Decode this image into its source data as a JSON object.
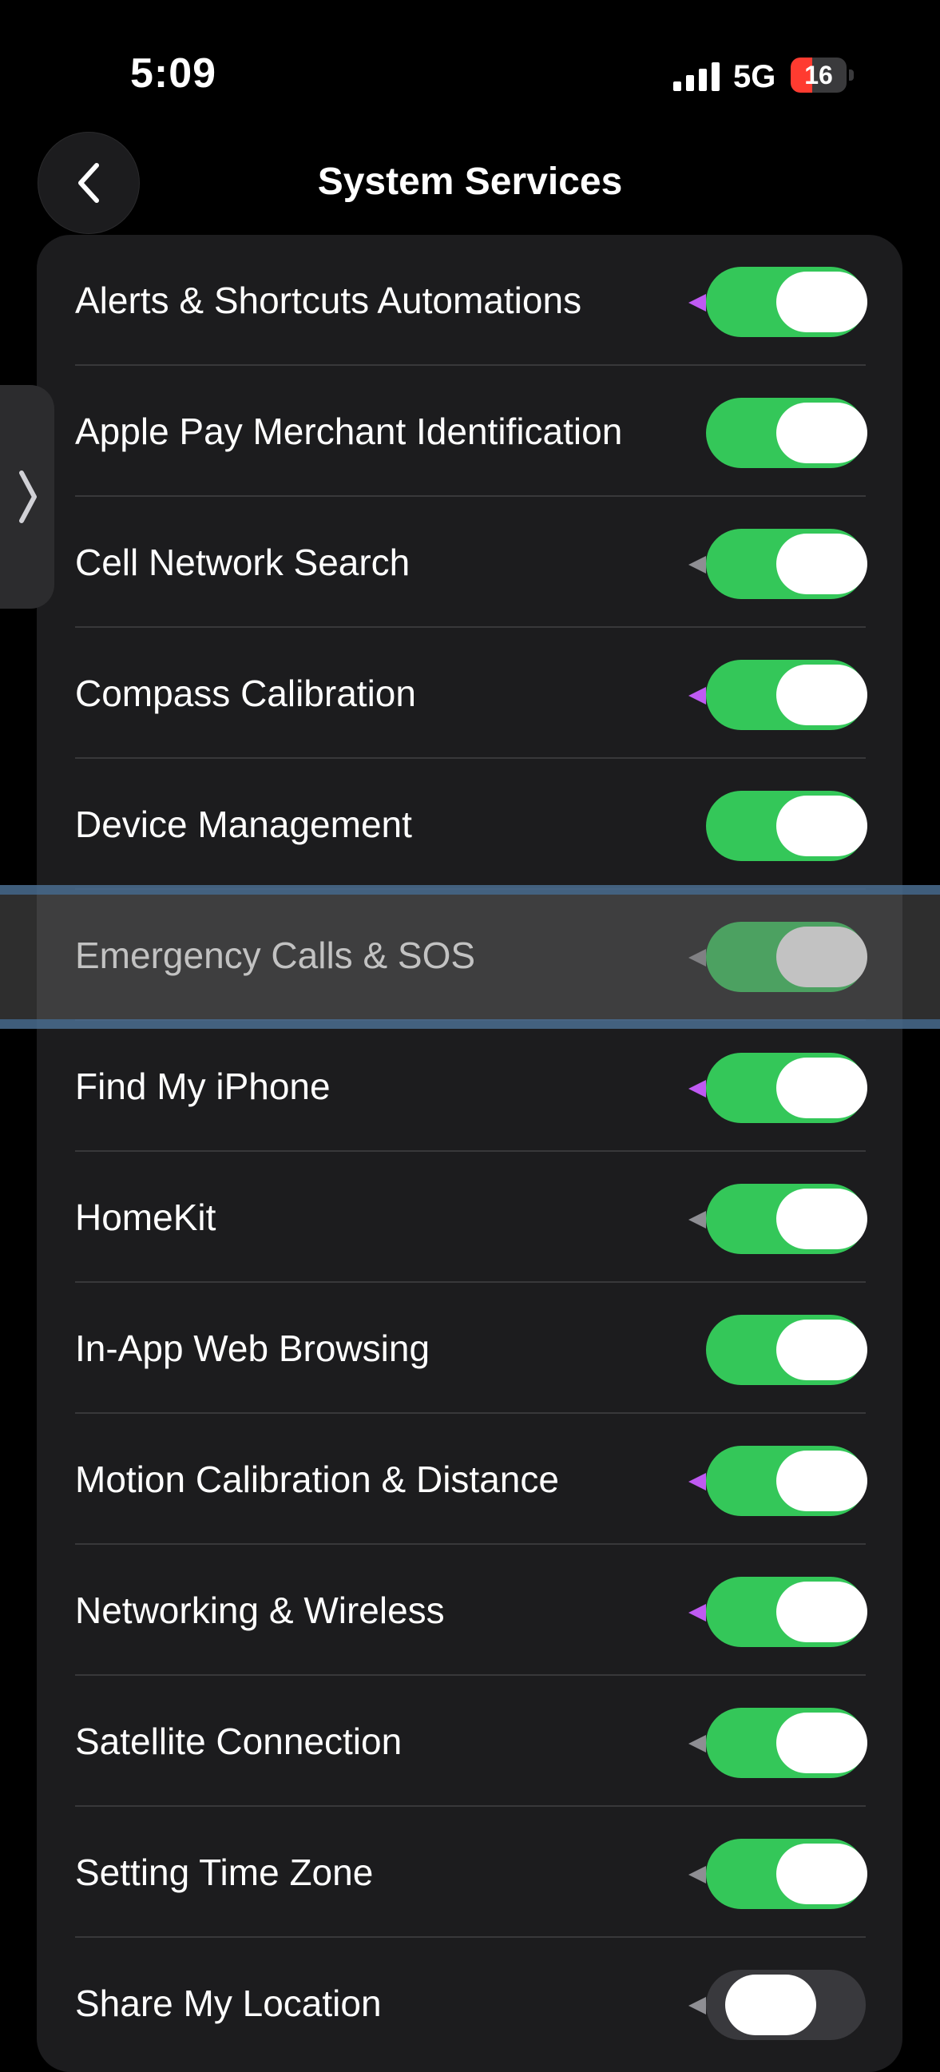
{
  "status_bar": {
    "time": "5:09",
    "network": "5G",
    "battery_level": "16",
    "battery_percent": 16,
    "battery_color": "#ff3b30"
  },
  "navigation": {
    "back_icon": "chevron-left-icon",
    "title": "System Services",
    "side_tab_icon": "chevron-right-icon"
  },
  "colors": {
    "toggle_on": "#34c759",
    "toggle_off": "#39393d",
    "location_recent": "#bf5af2",
    "location_used": "#8e8e93",
    "card": "#1c1c1e"
  },
  "services": [
    {
      "label": "Alerts & Shortcuts Automations",
      "on": true,
      "location_indicator": "purple"
    },
    {
      "label": "Apple Pay Merchant Identification",
      "on": true,
      "location_indicator": "none"
    },
    {
      "label": "Cell Network Search",
      "on": true,
      "location_indicator": "gray"
    },
    {
      "label": "Compass Calibration",
      "on": true,
      "location_indicator": "purple"
    },
    {
      "label": "Device Management",
      "on": true,
      "location_indicator": "none"
    },
    {
      "label": "Emergency Calls & SOS",
      "on": true,
      "location_indicator": "gray",
      "highlighted": true
    },
    {
      "label": "Find My iPhone",
      "on": true,
      "location_indicator": "purple"
    },
    {
      "label": "HomeKit",
      "on": true,
      "location_indicator": "gray"
    },
    {
      "label": "In-App Web Browsing",
      "on": true,
      "location_indicator": "none"
    },
    {
      "label": "Motion Calibration & Distance",
      "on": true,
      "location_indicator": "purple"
    },
    {
      "label": "Networking & Wireless",
      "on": true,
      "location_indicator": "purple"
    },
    {
      "label": "Satellite Connection",
      "on": true,
      "location_indicator": "gray"
    },
    {
      "label": "Setting Time Zone",
      "on": true,
      "location_indicator": "gray"
    },
    {
      "label": "Share My Location",
      "on": false,
      "location_indicator": "gray"
    }
  ]
}
